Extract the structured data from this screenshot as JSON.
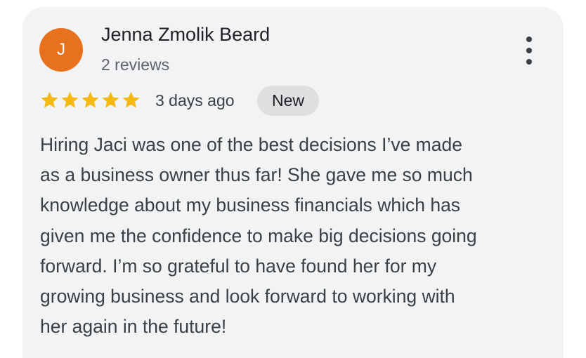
{
  "review": {
    "avatar_letter": "J",
    "reviewer_name": "Jenna Zmolik Beard",
    "review_count": "2 reviews",
    "rating": 5,
    "rating_max": 5,
    "time_ago": "3 days ago",
    "badge": "New",
    "text_lines": [
      "Hiring Jaci was one of the best decisions I’ve made",
      "as a business owner thus far! She gave me so much",
      "knowledge about my business financials which has",
      "given me the confidence to make big decisions going",
      "forward. I’m so grateful to have found her for my",
      "growing business and look forward to working with",
      "her again in the future!"
    ]
  },
  "icons": {
    "menu": "more-vert-icon",
    "star": "star-icon"
  },
  "colors": {
    "card_background": "#f1f3f4",
    "avatar": "#e8711e",
    "star": "#f5b914",
    "badge_background": "#dedfe1",
    "text_primary": "#202124",
    "text_secondary": "#5f6368"
  }
}
